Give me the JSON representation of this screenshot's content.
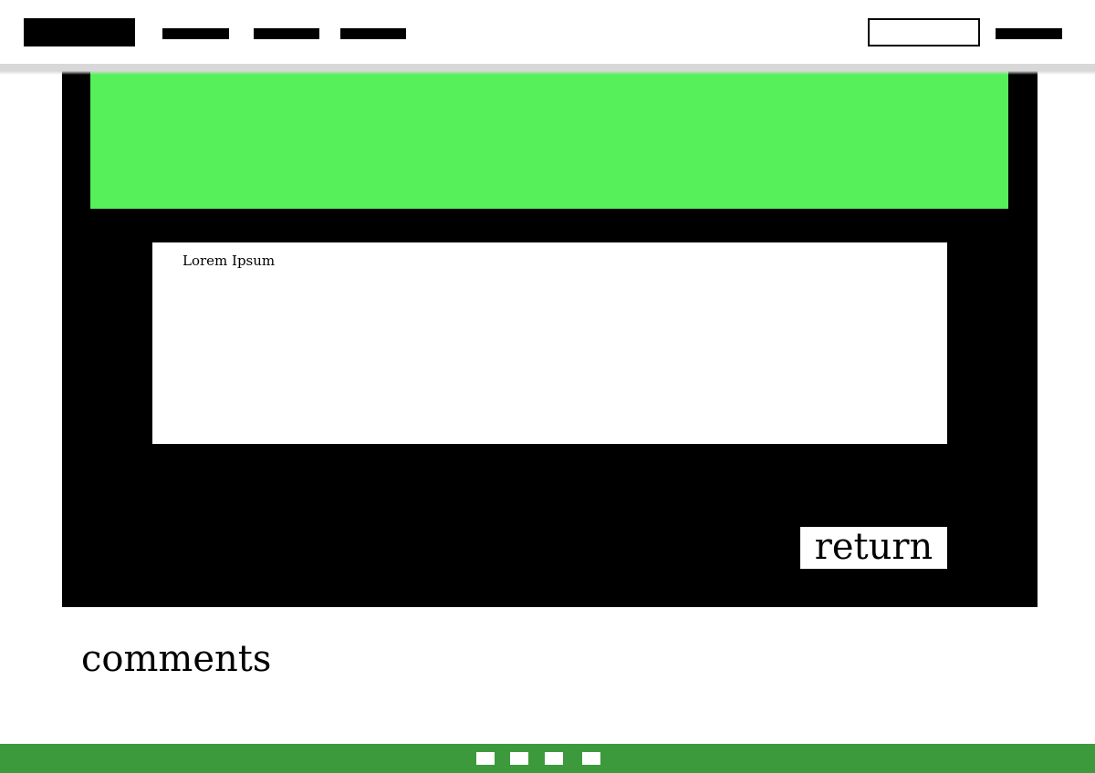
{
  "header": {
    "nav_items": [
      "",
      "",
      ""
    ],
    "search": {
      "value": "",
      "placeholder": ""
    }
  },
  "main": {
    "text_box": {
      "label": "Lorem Ipsum"
    },
    "return_label": "return"
  },
  "comments": {
    "heading": "comments"
  },
  "footer": {
    "links": [
      "",
      "",
      "",
      ""
    ]
  },
  "colors": {
    "banner": "#55f05a",
    "content_background": "#000000",
    "footer": "#3c9a3c",
    "header_shadow": "#d8d8d8"
  }
}
